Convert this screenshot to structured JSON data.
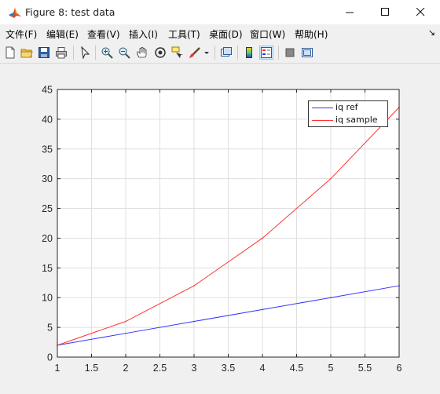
{
  "window": {
    "title": "Figure 8: test data",
    "minimize_glyph": "—",
    "maximize_glyph": "□",
    "close_glyph": "✕"
  },
  "menu": {
    "items": [
      "文件(F)",
      "编辑(E)",
      "查看(V)",
      "插入(I)",
      "工具(T)",
      "桌面(D)",
      "窗口(W)",
      "帮助(H)"
    ],
    "overflow_glyph": "↘"
  },
  "toolbar": {
    "icons": [
      "new-figure-icon",
      "open-file-icon",
      "save-icon",
      "print-icon",
      "pointer-icon",
      "zoom-in-icon",
      "zoom-out-icon",
      "pan-hand-icon",
      "rotate-3d-icon",
      "data-cursor-icon",
      "brush-icon",
      "brush-dropdown-icon",
      "link-plot-icon",
      "colorbar-icon",
      "legend-icon",
      "hide-plot-tools-icon",
      "show-plot-tools-icon"
    ]
  },
  "colors": {
    "accent_red": "#ff3333",
    "accent_blue": "#3333ff",
    "grid": "#dfdfdf"
  },
  "chart_data": {
    "type": "line",
    "x": [
      1,
      2,
      3,
      4,
      5,
      6
    ],
    "series": [
      {
        "name": "iq ref",
        "color": "#3333ff",
        "values": [
          2,
          4,
          6,
          8,
          10,
          12
        ]
      },
      {
        "name": "iq sample",
        "color": "#ff3333",
        "values": [
          2,
          6,
          12,
          20,
          30,
          42
        ]
      }
    ],
    "xlim": [
      1,
      6
    ],
    "ylim": [
      0,
      45
    ],
    "xticks": [
      "1",
      "1.5",
      "2",
      "2.5",
      "3",
      "3.5",
      "4",
      "4.5",
      "5",
      "5.5",
      "6"
    ],
    "yticks": [
      "0",
      "5",
      "10",
      "15",
      "20",
      "25",
      "30",
      "35",
      "40",
      "45"
    ],
    "grid": true,
    "legend_position": "top-right"
  }
}
